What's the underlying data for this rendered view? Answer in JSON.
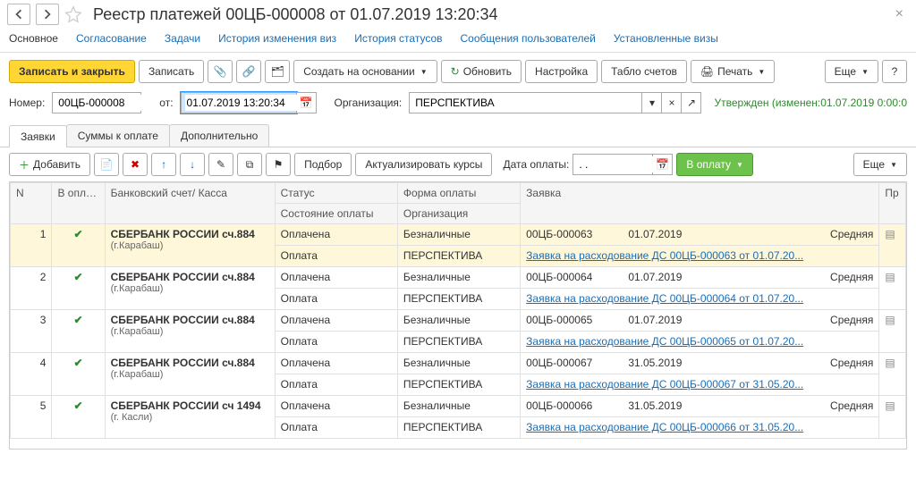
{
  "header": {
    "title": "Реестр платежей 00ЦБ-000008 от 01.07.2019 13:20:34"
  },
  "nav_links": {
    "main": "Основное",
    "approval": "Согласование",
    "tasks": "Задачи",
    "visa_history": "История изменения виз",
    "status_history": "История статусов",
    "user_messages": "Сообщения пользователей",
    "set_visas": "Установленные визы"
  },
  "toolbar": {
    "save_close": "Записать и закрыть",
    "save": "Записать",
    "create_based": "Создать на основании",
    "refresh": "Обновить",
    "settings": "Настройка",
    "accounts_board": "Табло счетов",
    "print": "Печать",
    "more": "Еще"
  },
  "fields": {
    "number_label": "Номер:",
    "number_value": "00ЦБ-000008",
    "from_label": "от:",
    "date_value": "01.07.2019 13:20:34",
    "org_label": "Организация:",
    "org_value": "ПЕРСПЕКТИВА",
    "status_text": "Утвержден (изменен:01.07.2019 0:00:0"
  },
  "tabs": {
    "requests": "Заявки",
    "sums": "Суммы к оплате",
    "extra": "Дополнительно"
  },
  "subtoolbar": {
    "add": "Добавить",
    "select": "Подбор",
    "update_rates": "Актуализировать курсы",
    "pay_date_label": "Дата оплаты:",
    "pay_date_value": ". .",
    "to_pay": "В оплату",
    "more": "Еще"
  },
  "grid": {
    "headers": {
      "n": "N",
      "to_pay": "В оплату",
      "bank": "Банковский счет/ Касса",
      "status": "Статус",
      "pay_state": "Состояние оплаты",
      "pay_form": "Форма оплаты",
      "org": "Организация",
      "request": "Заявка",
      "pr": "Пр"
    },
    "rows": [
      {
        "n": "1",
        "bank_main": "СБЕРБАНК РОССИИ сч.884",
        "bank_sub": "(г.Карабаш)",
        "status": "Оплачена",
        "pay_state": "Оплата",
        "pay_form": "Безналичные",
        "org": "ПЕРСПЕКТИВА",
        "req_no": "00ЦБ-000063",
        "req_date": "01.07.2019",
        "priority": "Средняя",
        "link": "Заявка на расходование ДС 00ЦБ-000063 от 01.07.20..."
      },
      {
        "n": "2",
        "bank_main": "СБЕРБАНК РОССИИ сч.884",
        "bank_sub": "(г.Карабаш)",
        "status": "Оплачена",
        "pay_state": "Оплата",
        "pay_form": "Безналичные",
        "org": "ПЕРСПЕКТИВА",
        "req_no": "00ЦБ-000064",
        "req_date": "01.07.2019",
        "priority": "Средняя",
        "link": "Заявка на расходование ДС 00ЦБ-000064 от 01.07.20..."
      },
      {
        "n": "3",
        "bank_main": "СБЕРБАНК РОССИИ сч.884",
        "bank_sub": "(г.Карабаш)",
        "status": "Оплачена",
        "pay_state": "Оплата",
        "pay_form": "Безналичные",
        "org": "ПЕРСПЕКТИВА",
        "req_no": "00ЦБ-000065",
        "req_date": "01.07.2019",
        "priority": "Средняя",
        "link": "Заявка на расходование ДС 00ЦБ-000065 от 01.07.20..."
      },
      {
        "n": "4",
        "bank_main": "СБЕРБАНК РОССИИ сч.884",
        "bank_sub": "(г.Карабаш)",
        "status": "Оплачена",
        "pay_state": "Оплата",
        "pay_form": "Безналичные",
        "org": "ПЕРСПЕКТИВА",
        "req_no": "00ЦБ-000067",
        "req_date": "31.05.2019",
        "priority": "Средняя",
        "link": "Заявка на расходование ДС 00ЦБ-000067 от 31.05.20..."
      },
      {
        "n": "5",
        "bank_main": "СБЕРБАНК РОССИИ сч 1494",
        "bank_sub": "(г. Касли)",
        "status": "Оплачена",
        "pay_state": "Оплата",
        "pay_form": "Безналичные",
        "org": "ПЕРСПЕКТИВА",
        "req_no": "00ЦБ-000066",
        "req_date": "31.05.2019",
        "priority": "Средняя",
        "link": "Заявка на расходование ДС 00ЦБ-000066 от 31.05.20..."
      }
    ]
  },
  "colors": {
    "accent_yellow": "#ffd633",
    "accent_green": "#6cc24a",
    "link": "#1a6db5",
    "status_green": "#2d8a2d"
  }
}
